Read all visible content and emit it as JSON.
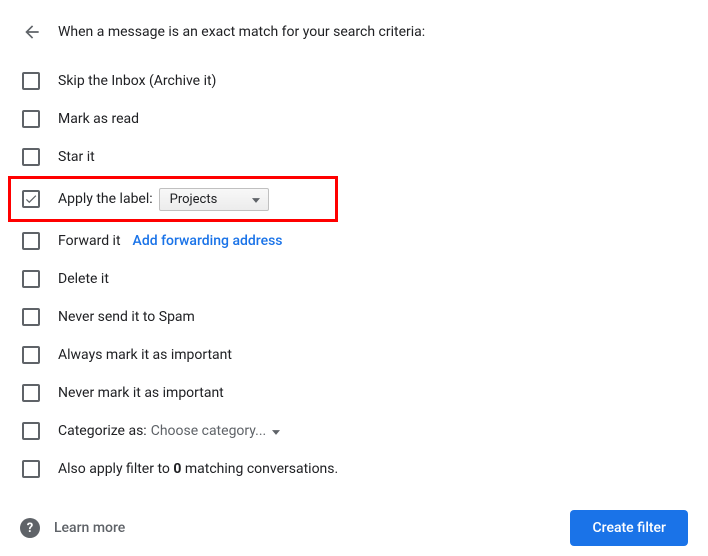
{
  "header": {
    "title": "When a message is an exact match for your search criteria:"
  },
  "options": {
    "skip_inbox": "Skip the Inbox (Archive it)",
    "mark_read": "Mark as read",
    "star_it": "Star it",
    "apply_label": "Apply the label:",
    "apply_label_value": "Projects",
    "forward_it": "Forward it",
    "forward_link": "Add forwarding address",
    "delete_it": "Delete it",
    "never_spam": "Never send it to Spam",
    "always_important": "Always mark it as important",
    "never_important": "Never mark it as important",
    "categorize_as": "Categorize as:",
    "categorize_value": "Choose category...",
    "also_apply_before": "Also apply filter to ",
    "also_apply_count": "0",
    "also_apply_after": " matching conversations."
  },
  "footer": {
    "learn_more": "Learn more",
    "create_filter": "Create filter"
  }
}
